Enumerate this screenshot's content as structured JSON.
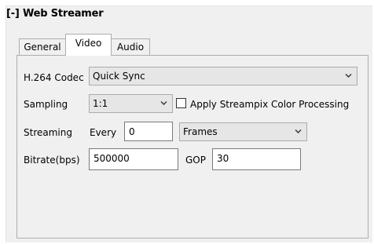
{
  "group": {
    "title": "[-] Web Streamer"
  },
  "tabs": [
    {
      "label": "General",
      "active": false
    },
    {
      "label": "Video",
      "active": true
    },
    {
      "label": "Audio",
      "active": false
    }
  ],
  "video": {
    "codec": {
      "label": "H.264 Codec",
      "value": "Quick Sync"
    },
    "sampling": {
      "label": "Sampling",
      "value": "1:1"
    },
    "color_processing": {
      "label": "Apply Streampix Color Processing",
      "checked": false
    },
    "streaming": {
      "label": "Streaming",
      "every_label": "Every",
      "every_value": "0",
      "unit": "Frames"
    },
    "bitrate": {
      "label": "Bitrate(bps)",
      "value": "500000"
    },
    "gop": {
      "label": "GOP",
      "value": "30"
    }
  },
  "icons": {
    "dropdown": "chevron-down-icon"
  }
}
